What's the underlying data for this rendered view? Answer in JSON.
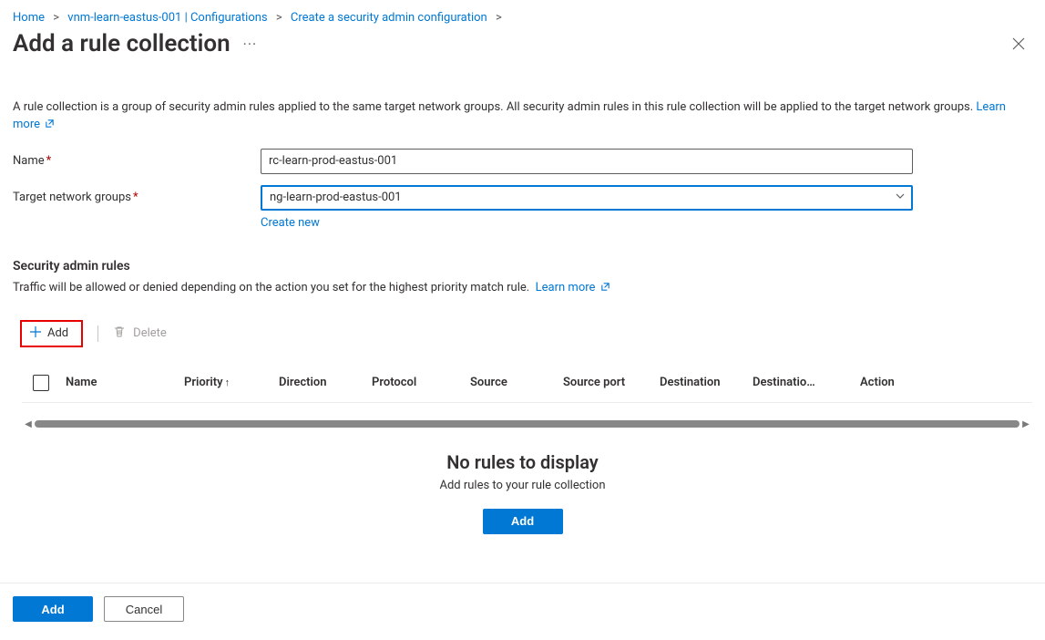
{
  "breadcrumb": {
    "home": "Home",
    "item1": "vnm-learn-eastus-001 | Configurations",
    "item2": "Create a security admin configuration"
  },
  "page": {
    "title": "Add a rule collection",
    "description": "A rule collection is a group of security admin rules applied to the same target network groups. All security admin rules in this rule collection will be applied to the target network groups.",
    "learn_more": "Learn more"
  },
  "form": {
    "name_label": "Name",
    "name_value": "rc-learn-prod-eastus-001",
    "target_label": "Target network groups",
    "target_value": "ng-learn-prod-eastus-001",
    "create_new": "Create new"
  },
  "section": {
    "header": "Security admin rules",
    "desc": "Traffic will be allowed or denied depending on the action you set for the highest priority match rule.",
    "learn_more": "Learn more"
  },
  "toolbar": {
    "add": "Add",
    "delete": "Delete"
  },
  "table": {
    "col_name": "Name",
    "col_priority": "Priority",
    "col_direction": "Direction",
    "col_protocol": "Protocol",
    "col_source": "Source",
    "col_source_port": "Source port",
    "col_destination": "Destination",
    "col_destination_port": "Destinatio…",
    "col_action": "Action"
  },
  "empty": {
    "title": "No rules to display",
    "subtitle": "Add rules to your rule collection",
    "button": "Add"
  },
  "footer": {
    "add": "Add",
    "cancel": "Cancel"
  }
}
